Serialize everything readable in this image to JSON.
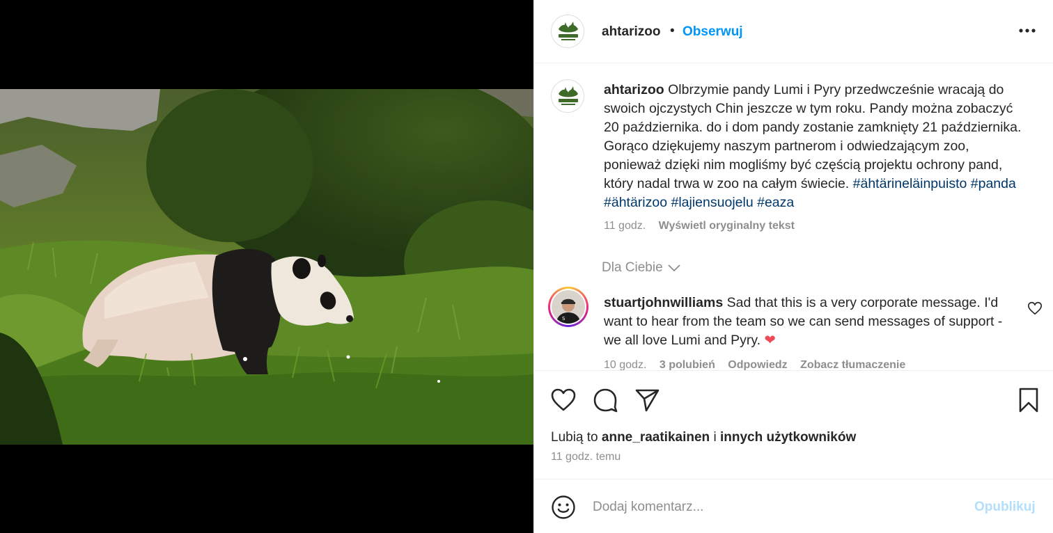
{
  "post": {
    "username": "ahtarizoo",
    "separator": "•",
    "follow_label": "Obserwuj",
    "avatar_logo_text": "ÄHTÄRI ZOO",
    "image_alt": "Giant panda walking on grass"
  },
  "caption": {
    "username": "ahtarizoo",
    "text": "Olbrzymie pandy Lumi i Pyry przedwcześnie wracają do swoich ojczystych Chin jeszcze w tym roku. Pandy można zobaczyć 20 października. do i dom pandy zostanie zamknięty 21 października. Gorąco dziękujemy naszym partnerom i odwiedzającym zoo, ponieważ dzięki nim mogliśmy być częścią projektu ochrony pand, który nadal trwa w zoo na całym świecie.",
    "hashtags": [
      "#ähtärineläinpuisto",
      "#panda",
      "#ähtärizoo",
      "#lajiensuojelu",
      "#eaza"
    ],
    "time": "11 godz.",
    "translate_label": "Wyświetl oryginalny tekst"
  },
  "for_you_label": "Dla Ciebie",
  "comment": {
    "username": "stuartjohnwilliams",
    "text": "Sad that this is a very corporate message. I'd want to hear from the team so we can send messages of support - we all love Lumi and Pyry.",
    "emoji": "❤",
    "time": "10 godz.",
    "likes": "3 polubień",
    "reply_label": "Odpowiedz",
    "translate_label": "Zobacz tłumaczenie"
  },
  "likes": {
    "prefix": "Lubią to",
    "user": "anne_raatikainen",
    "connector": "i",
    "others": "innych użytkowników"
  },
  "timestamp": "11 godz. temu",
  "add_comment": {
    "placeholder": "Dodaj komentarz...",
    "publish_label": "Opublikuj"
  },
  "colors": {
    "link": "#0095f6",
    "hashtag": "#00376b",
    "publish_disabled": "#b2dffc",
    "heart": "#ed4956"
  }
}
